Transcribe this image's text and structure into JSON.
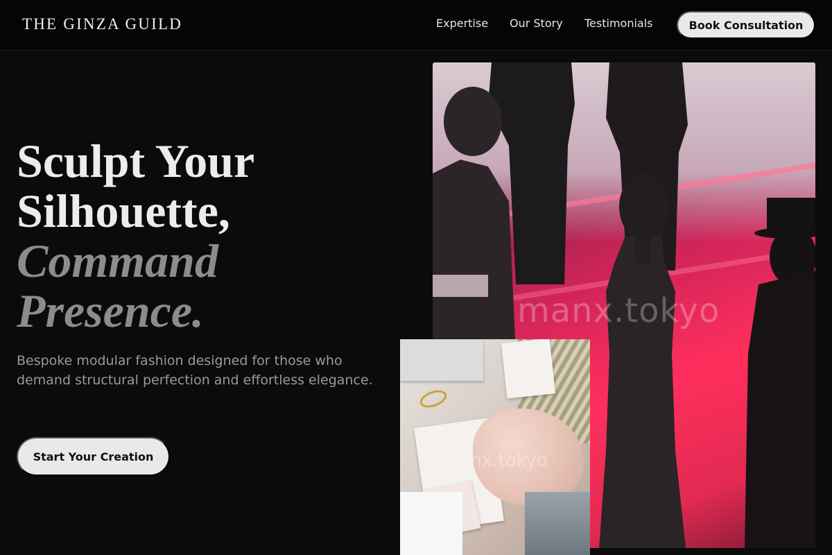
{
  "header": {
    "brand": "THE GINZA GUILD",
    "nav": [
      {
        "label": "Expertise"
      },
      {
        "label": "Our Story"
      },
      {
        "label": "Testimonials"
      }
    ],
    "cta_label": "Book Consultation"
  },
  "hero": {
    "title_line1": "Sculpt Your",
    "title_line2": "Silhouette,",
    "title_line3": "Command",
    "title_line4": "Presence.",
    "subtitle": "Bespoke modular fashion designed for those who demand structural perfection and effortless elegance.",
    "cta_label": "Start Your Creation"
  },
  "images": {
    "main_watermark": "manx.tokyo",
    "small_watermark": "manx.tokyo"
  },
  "colors": {
    "background": "#0b0b0b",
    "header_background": "#050505",
    "button_background": "#e9e9e9",
    "accent_pink": "#ff2f5c"
  }
}
